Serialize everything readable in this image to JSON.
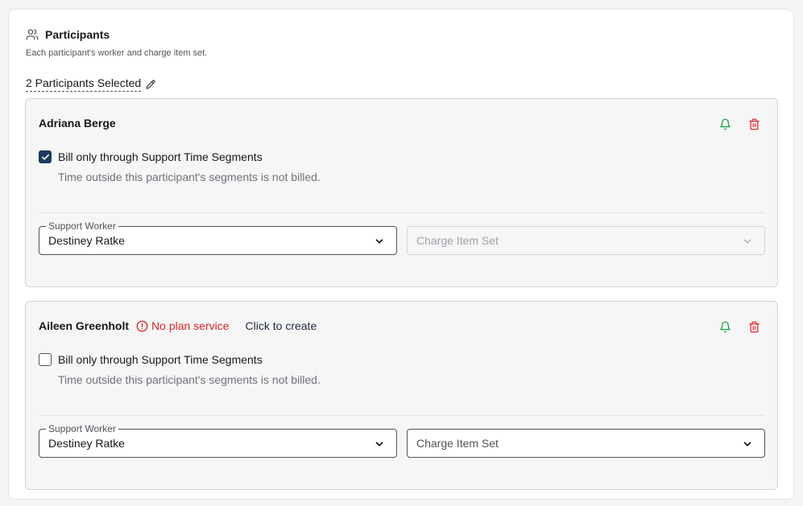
{
  "section": {
    "title": "Participants",
    "subtitle": "Each participant's worker and charge item set.",
    "selected_label": "2 Participants Selected"
  },
  "participants": [
    {
      "name": "Adriana Berge",
      "warning": "",
      "create_link": "",
      "checkbox_label": "Bill only through Support Time Segments",
      "checkbox_checked": true,
      "hint": "Time outside this participant's segments is not billed.",
      "support_worker_label": "Support Worker",
      "support_worker_value": "Destiney Ratke",
      "charge_item_placeholder": "Charge Item Set",
      "charge_item_disabled": true
    },
    {
      "name": "Aileen Greenholt",
      "warning": "No plan service",
      "create_link": "Click to create",
      "checkbox_label": "Bill only through Support Time Segments",
      "checkbox_checked": false,
      "hint": "Time outside this participant's segments is not billed.",
      "support_worker_label": "Support Worker",
      "support_worker_value": "Destiney Ratke",
      "charge_item_placeholder": "Charge Item Set",
      "charge_item_disabled": false
    }
  ],
  "icons": {
    "section": "users-icon",
    "edit": "pencil-icon",
    "warning": "alert-circle-icon",
    "notify": "bell-icon",
    "delete": "trash-icon",
    "checked": "check-icon",
    "dropdown": "chevron-down-icon"
  },
  "colors": {
    "danger": "#dc2626",
    "bell": "#16a34a",
    "checkbox_checked": "#1e3a5f",
    "border": "#d4d4d8"
  }
}
